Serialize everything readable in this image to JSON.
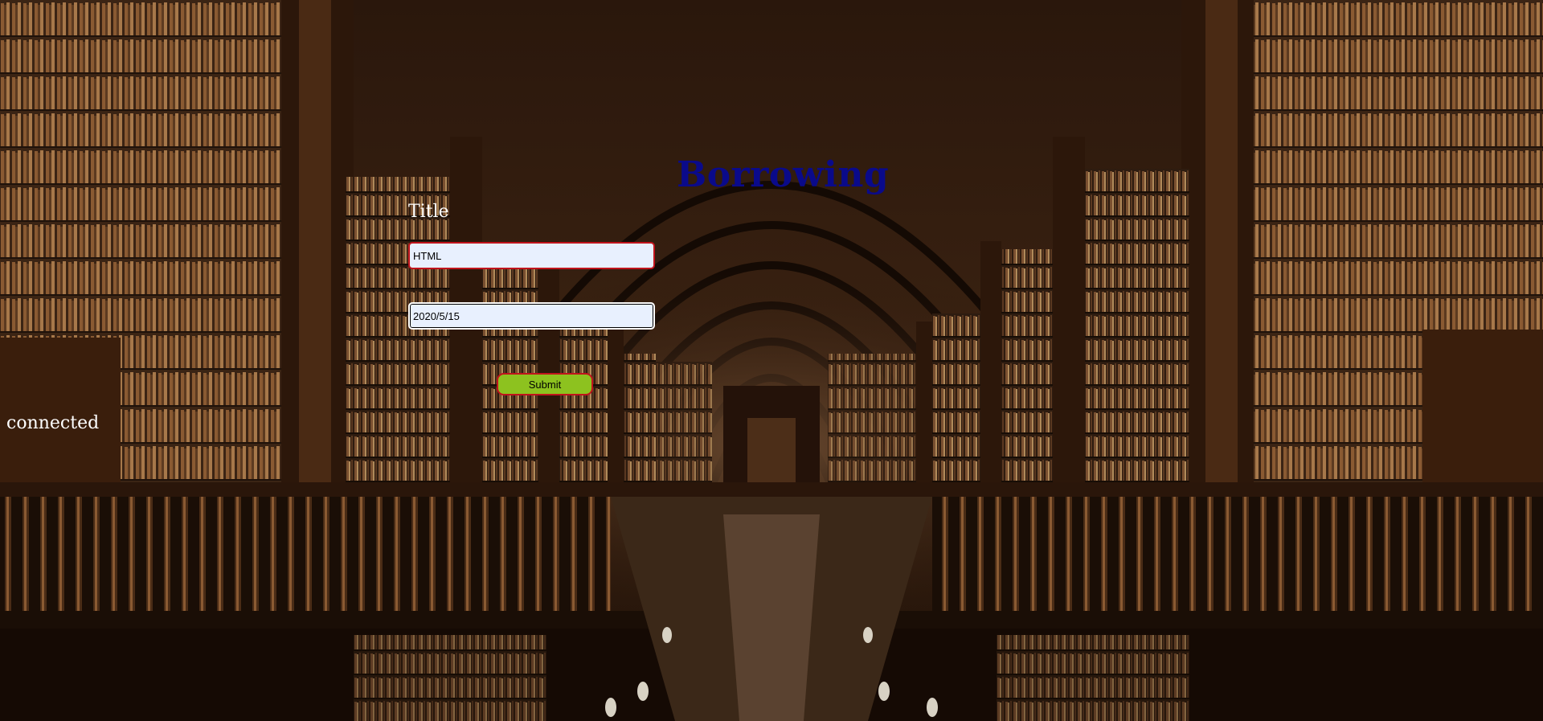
{
  "page": {
    "heading": "Borrowing",
    "status": "connected"
  },
  "form": {
    "title_label": "Title",
    "title_value": "HTML",
    "date_value": "2020/5/15",
    "submit_label": "Submit"
  },
  "colors": {
    "heading": "#0a0a8a",
    "submit_background": "#8dc21f",
    "input_border_focus": "#c0141c",
    "input_background": "#e8f0fe"
  },
  "background": {
    "description_icon": "library-hall-image"
  }
}
